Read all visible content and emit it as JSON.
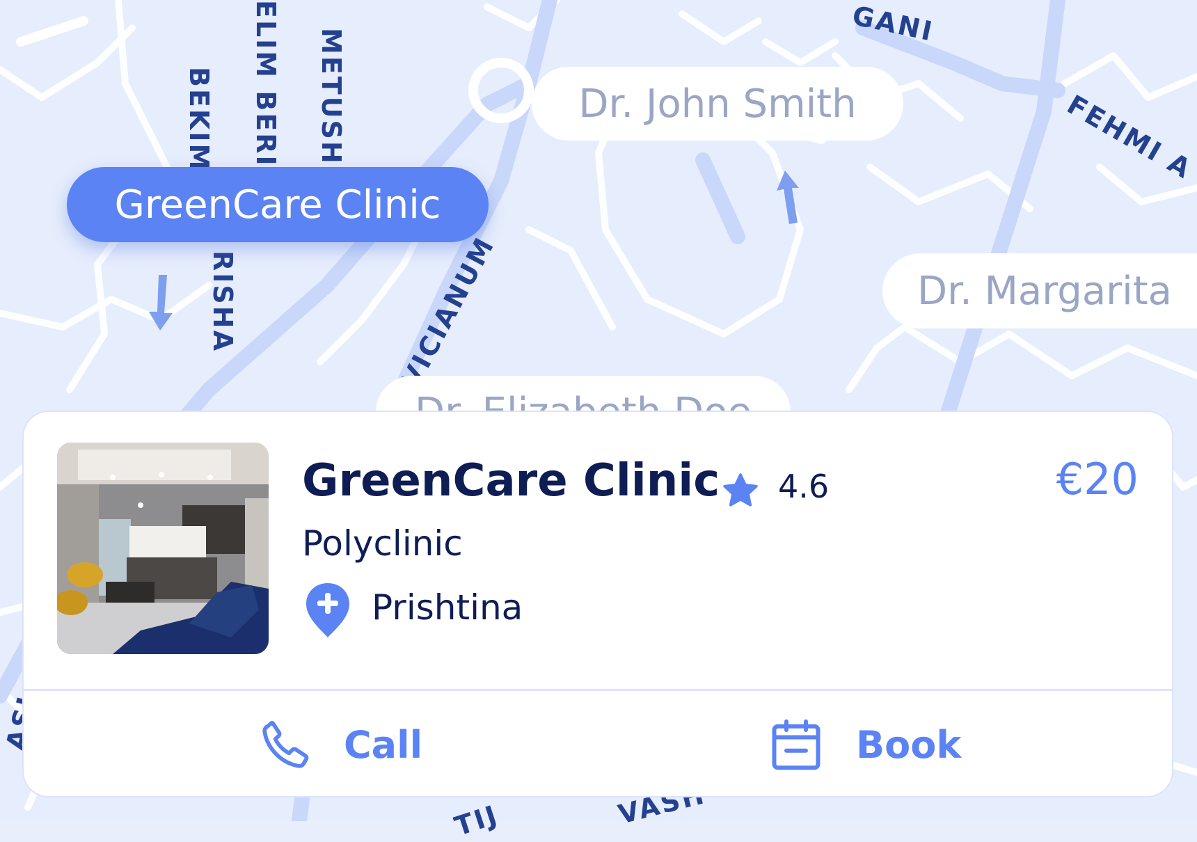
{
  "map": {
    "streets": [
      "BEKIM",
      "ELIM BERI",
      "METUSH",
      "RISHA",
      "VICIANUM",
      "GANI",
      "FEHMI A",
      "ASL",
      "TIJ",
      "VASH"
    ],
    "markers": [
      {
        "label": "GreenCare Clinic",
        "active": true
      },
      {
        "label": "Dr. John Smith",
        "active": false
      },
      {
        "label": "Dr. Margarita",
        "active": false
      },
      {
        "label": "Dr. Elizabeth Doe",
        "active": false
      }
    ]
  },
  "card": {
    "photo_icon": "clinic-reception-photo",
    "title": "GreenCare Clinic",
    "rating": "4.6",
    "price": "€20",
    "category": "Polyclinic",
    "location": "Prishtina",
    "actions": {
      "call": "Call",
      "book": "Book"
    }
  },
  "colors": {
    "accent": "#5b83f4",
    "ink": "#0e1d54",
    "map_bg": "#e8eefc",
    "road": "#ffffff"
  }
}
